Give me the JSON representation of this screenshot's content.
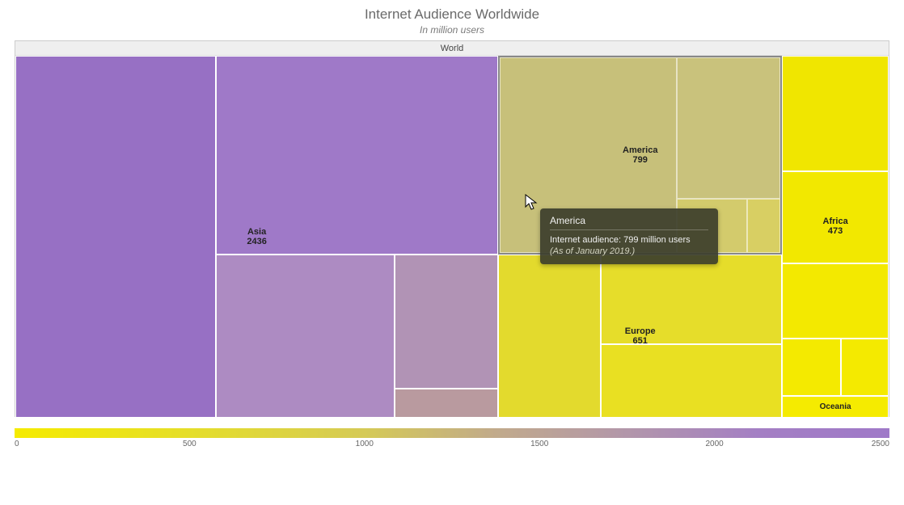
{
  "title": "Internet Audience Worldwide",
  "subtitle": "In million users",
  "root_label": "World",
  "tooltip": {
    "title": "America",
    "line": "Internet audience: 799 million users",
    "note": "(As of January 2019.)"
  },
  "scale_ticks": [
    "0",
    "500",
    "1000",
    "1500",
    "2000",
    "2500"
  ],
  "chart_data": {
    "type": "treemap",
    "title": "Internet Audience Worldwide",
    "subtitle": "In million users",
    "root": "World",
    "unit": "million users",
    "regions": [
      {
        "name": "Asia",
        "value": 2436,
        "color": "#9f79c8"
      },
      {
        "name": "America",
        "value": 799,
        "color": "#c7c07a"
      },
      {
        "name": "Europe",
        "value": 651,
        "color": "#e3da2d"
      },
      {
        "name": "Africa",
        "value": 473,
        "color": "#f0e600"
      },
      {
        "name": "Oceania",
        "value": 29,
        "color": "#f5eb00"
      }
    ],
    "color_scale": {
      "min": 0,
      "max": 2500
    },
    "as_of": "January 2019"
  }
}
